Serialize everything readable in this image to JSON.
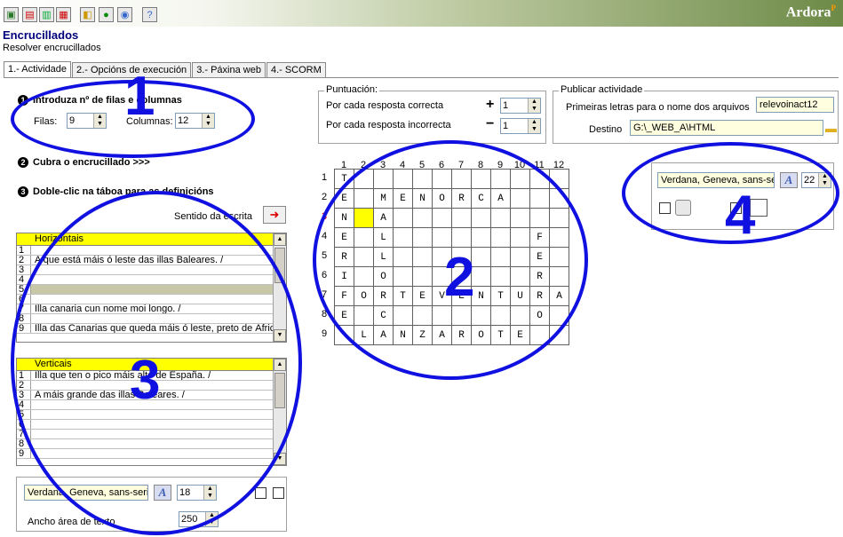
{
  "brand": {
    "name": "Ardora",
    "sup": "P"
  },
  "title": "Encrucillados",
  "subtitle": "Resolver encrucillados",
  "tabs": [
    {
      "label": "1.- Actividade"
    },
    {
      "label": "2.- Opcións de execución"
    },
    {
      "label": "3.- Páxina web"
    },
    {
      "label": "4.- SCORM"
    }
  ],
  "step1": {
    "num": "1",
    "label": "Introduza nº de filas e columnas",
    "rows_label": "Filas:",
    "rows": "9",
    "cols_label": "Columnas:",
    "cols": "12"
  },
  "step2": {
    "num": "2",
    "label": "Cubra o encrucillado >>>"
  },
  "step3": {
    "num": "3",
    "label": "Doble-clic na táboa para as definicións",
    "direction_label": "Sentido da escrita"
  },
  "score": {
    "title": "Puntuación:",
    "correct_label": "Por cada resposta correcta",
    "correct_sign": "+",
    "correct_value": "1",
    "incorrect_label": "Por cada resposta incorrecta",
    "incorrect_sign": "−",
    "incorrect_value": "1"
  },
  "publish": {
    "title": "Publicar actividade",
    "prefix_label": "Primeiras letras para o nome dos arquivos",
    "prefix_value": "relevoinact12",
    "dest_label": "Destino",
    "dest_value": "G:\\_WEB_A\\HTML"
  },
  "horizontal": {
    "header": "Horizontais",
    "rows": [
      {
        "num": "1",
        "text": ""
      },
      {
        "num": "2",
        "text": "A que está máis ó leste das illas Baleares. /"
      },
      {
        "num": "3",
        "text": ""
      },
      {
        "num": "4",
        "text": ""
      },
      {
        "num": "5",
        "text": ""
      },
      {
        "num": "6",
        "text": ""
      },
      {
        "num": "7",
        "text": "Illa canaria cun nome moi longo. /"
      },
      {
        "num": "8",
        "text": ""
      },
      {
        "num": "9",
        "text": "Illa das Canarias que queda máis ó leste, preto de África. /"
      }
    ]
  },
  "vertical": {
    "header": "Verticais",
    "rows": [
      {
        "num": "1",
        "text": "Illa que ten o pico máis alto de España. /"
      },
      {
        "num": "2",
        "text": ""
      },
      {
        "num": "3",
        "text": "A máis grande das illas Baleares. /"
      },
      {
        "num": "4",
        "text": ""
      },
      {
        "num": "5",
        "text": ""
      },
      {
        "num": "6",
        "text": ""
      },
      {
        "num": "7",
        "text": ""
      },
      {
        "num": "8",
        "text": ""
      },
      {
        "num": "9",
        "text": ""
      }
    ]
  },
  "font_bottom": {
    "family": "Verdana, Geneva, sans-serif",
    "size": "18",
    "width_label": "Ancho área de texto",
    "width": "250"
  },
  "font_right": {
    "family": "Verdana, Geneva, sans-serif",
    "size": "22"
  },
  "grid": {
    "col_numbers": [
      "1",
      "2",
      "3",
      "4",
      "5",
      "6",
      "7",
      "8",
      "9",
      "10",
      "11",
      "12"
    ],
    "row_numbers": [
      "1",
      "2",
      "3",
      "4",
      "5",
      "6",
      "7",
      "8",
      "9"
    ],
    "rows": [
      [
        "T",
        "",
        "",
        "",
        "",
        "",
        "",
        "",
        "",
        "",
        "",
        ""
      ],
      [
        "E",
        "",
        "M",
        "E",
        "N",
        "O",
        "R",
        "C",
        "A",
        "",
        "",
        ""
      ],
      [
        "N",
        "",
        "A",
        "",
        "",
        "",
        "",
        "",
        "",
        "",
        "",
        ""
      ],
      [
        "E",
        "",
        "L",
        "",
        "",
        "",
        "",
        "",
        "",
        "",
        "F",
        ""
      ],
      [
        "R",
        "",
        "L",
        "",
        "",
        "",
        "",
        "",
        "",
        "",
        "E",
        ""
      ],
      [
        "I",
        "",
        "O",
        "",
        "",
        "",
        "",
        "",
        "",
        "",
        "R",
        ""
      ],
      [
        "F",
        "O",
        "R",
        "T",
        "E",
        "V",
        "E",
        "N",
        "T",
        "U",
        "R",
        "A"
      ],
      [
        "E",
        "",
        "C",
        "",
        "",
        "",
        "",
        "",
        "",
        "",
        "O",
        ""
      ],
      [
        "",
        "L",
        "A",
        "N",
        "Z",
        "A",
        "R",
        "O",
        "T",
        "E",
        "",
        ""
      ]
    ]
  },
  "annotations": [
    "1",
    "2",
    "3",
    "4"
  ],
  "colors": {
    "accent": "#1010e0",
    "header": "#ffff00",
    "title": "#00007a"
  }
}
